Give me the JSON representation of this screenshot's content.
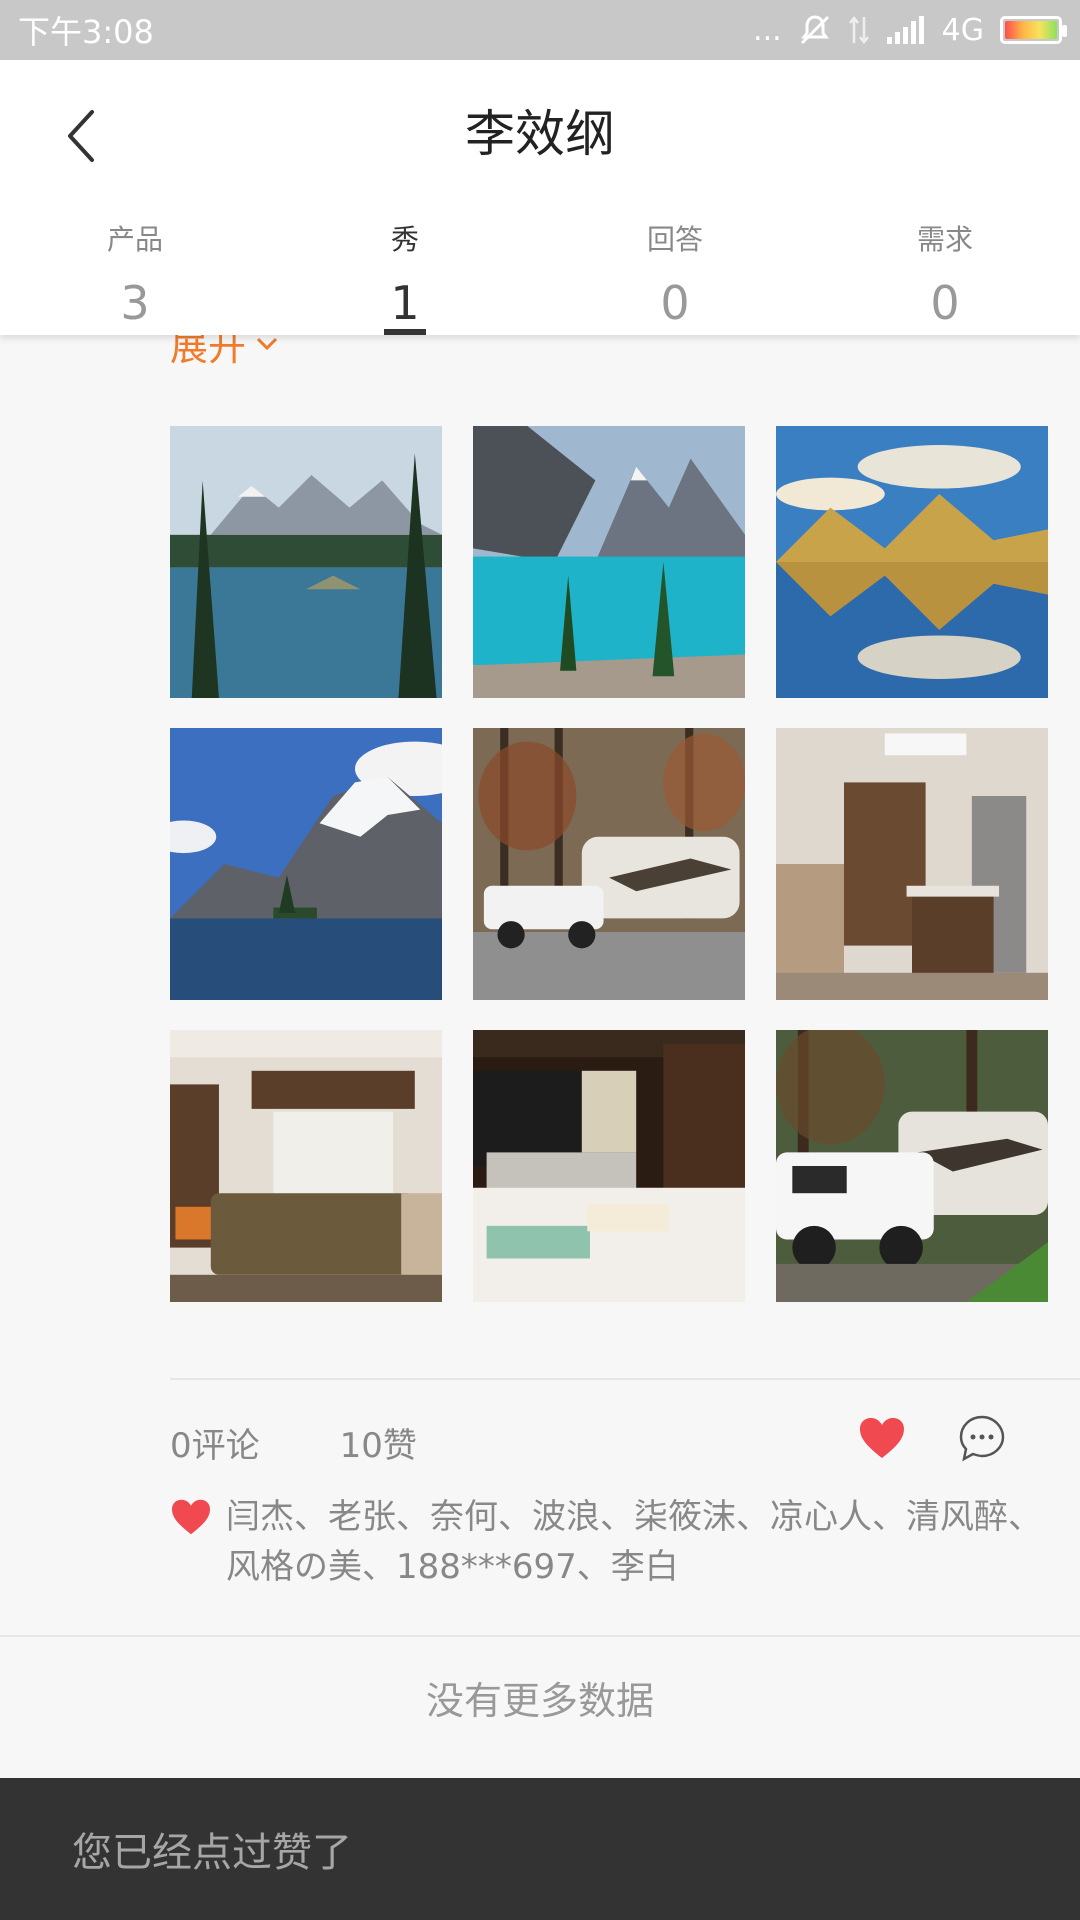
{
  "status_bar": {
    "time": "下午3:08",
    "dots": "...",
    "network": "4G",
    "battery_level": 1.0
  },
  "header": {
    "title": "李效纲",
    "back_icon": "chevron-left-icon"
  },
  "tabs": [
    {
      "label": "产品",
      "count": "3",
      "active": false
    },
    {
      "label": "秀",
      "count": "1",
      "active": true
    },
    {
      "label": "回答",
      "count": "0",
      "active": false
    },
    {
      "label": "需求",
      "count": "0",
      "active": false
    }
  ],
  "post": {
    "expand_label": "展开",
    "photos": [
      {
        "name": "photo-lake-forest",
        "scene": "mountain lake with pine trees"
      },
      {
        "name": "photo-turquoise-lake",
        "scene": "turquoise glacial lake"
      },
      {
        "name": "photo-lake-reflection",
        "scene": "mountain reflection lake"
      },
      {
        "name": "photo-snow-mountain",
        "scene": "snowy mountain and island"
      },
      {
        "name": "photo-truck-rv-forest",
        "scene": "truck towing fifth wheel in forest"
      },
      {
        "name": "photo-rv-kitchen",
        "scene": "rv interior kitchen"
      },
      {
        "name": "photo-rv-living",
        "scene": "rv interior living room"
      },
      {
        "name": "photo-rv-bedroom",
        "scene": "rv interior bedroom"
      },
      {
        "name": "photo-truck-rv-roadside",
        "scene": "white truck with fifth wheel roadside"
      }
    ],
    "comment_count": "0评论",
    "like_count": "10赞",
    "liked": true,
    "likers_text": "闫杰、老张、奈何、波浪、柒筱沫、凉心人、清风醉、风格の美、188***697、李白"
  },
  "footer": {
    "no_more_text": "没有更多数据"
  },
  "toast": {
    "message": "您已经点过赞了"
  },
  "colors": {
    "accent_orange": "#f07b2a",
    "like_red": "#f0494f",
    "toast_bg": "#333333"
  }
}
